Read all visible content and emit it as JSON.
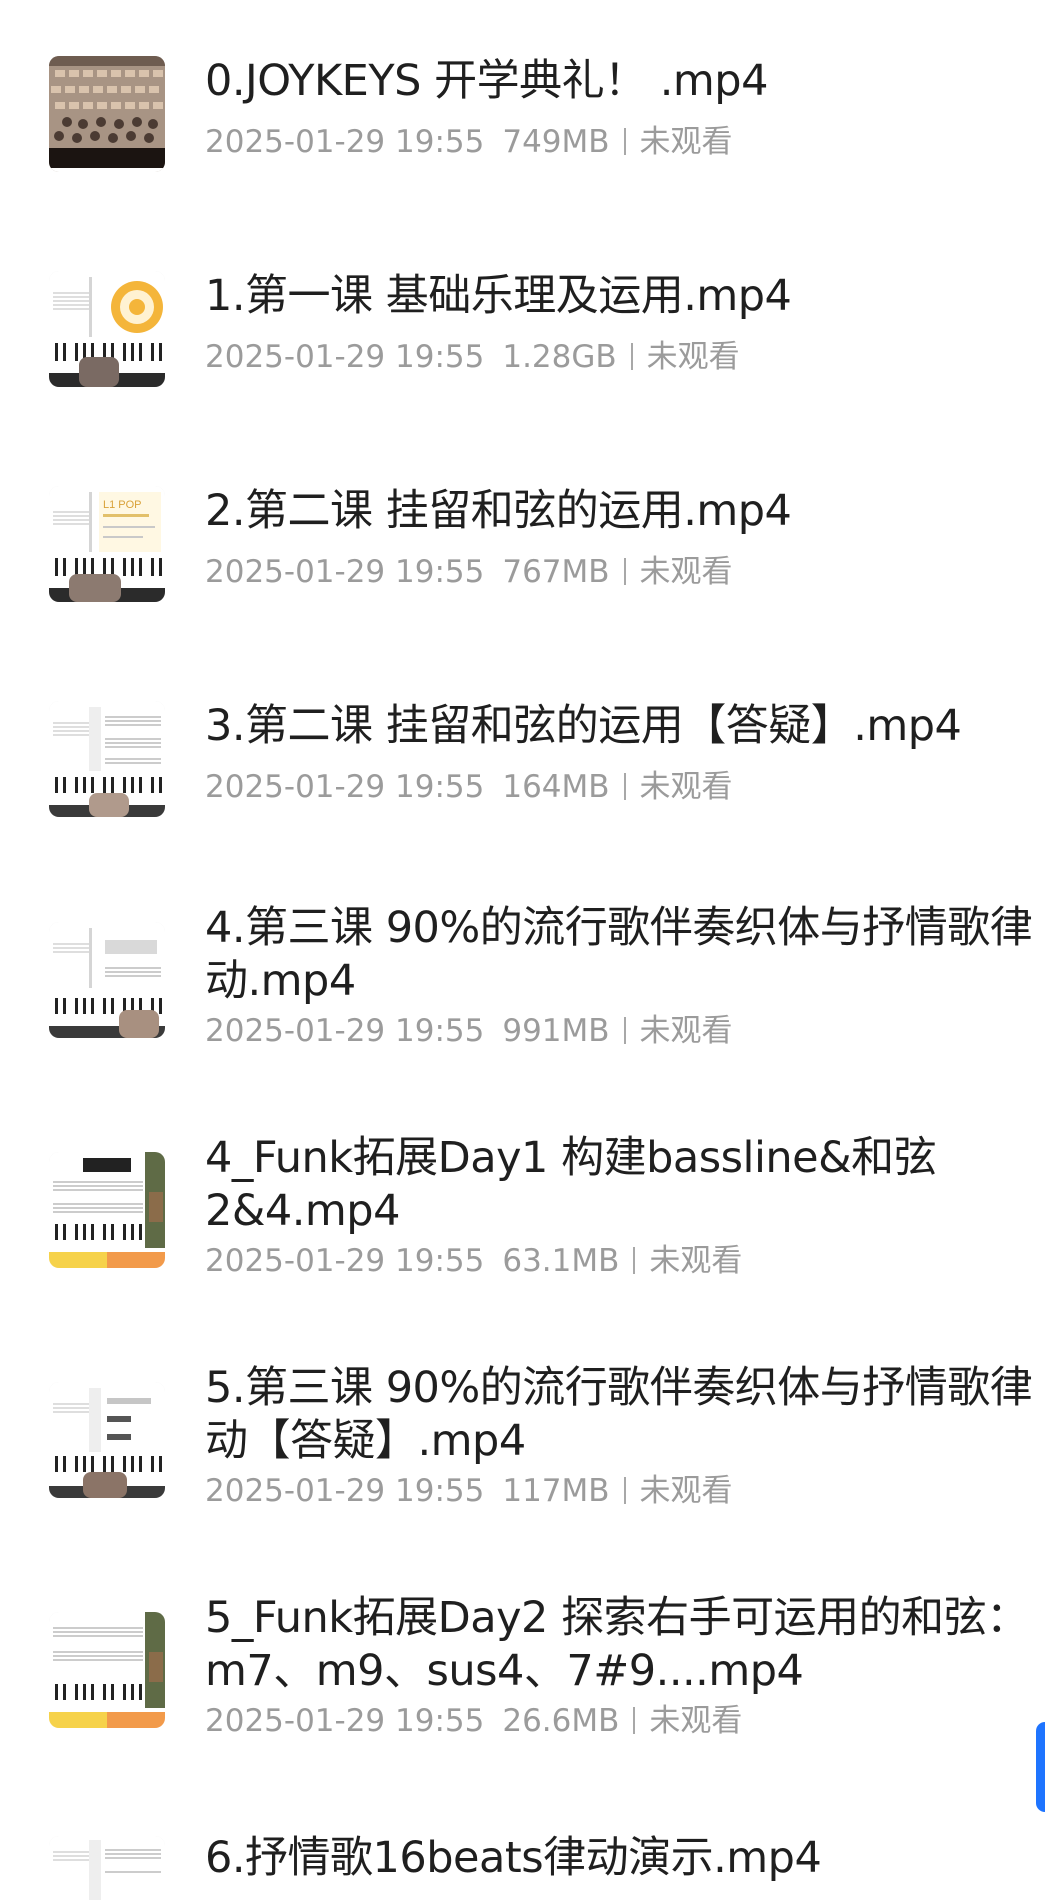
{
  "files": [
    {
      "title": "0.JOYKEYS 开学典礼！ .mp4",
      "date": "2025-01-29 19:55",
      "size": "749MB",
      "status": "未观看",
      "thumb": "ceremony"
    },
    {
      "title": "1.第一课 基础乐理及运用.mp4",
      "date": "2025-01-29 19:55",
      "size": "1.28GB",
      "status": "未观看",
      "thumb": "wheel"
    },
    {
      "title": "2.第二课 挂留和弦的运用.mp4",
      "date": "2025-01-29 19:55",
      "size": "767MB",
      "status": "未观看",
      "thumb": "slide"
    },
    {
      "title": "3.第二课 挂留和弦的运用【答疑】.mp4",
      "date": "2025-01-29 19:55",
      "size": "164MB",
      "status": "未观看",
      "thumb": "score"
    },
    {
      "title": "4.第三课 90%的流行歌伴奏织体与抒情歌律动.mp4",
      "date": "2025-01-29 19:55",
      "size": "991MB",
      "status": "未观看",
      "thumb": "score"
    },
    {
      "title": "4_Funk拓展Day1 构建bassline&和弦2&4.mp4",
      "date": "2025-01-29 19:55",
      "size": "63.1MB",
      "status": "未观看",
      "thumb": "funk"
    },
    {
      "title": "5.第三课 90%的流行歌伴奏织体与抒情歌律动【答疑】.mp4",
      "date": "2025-01-29 19:55",
      "size": "117MB",
      "status": "未观看",
      "thumb": "score"
    },
    {
      "title": "5_Funk拓展Day2 探索右手可运用的和弦：m7、m9、sus4、7#9....mp4",
      "date": "2025-01-29 19:55",
      "size": "26.6MB",
      "status": "未观看",
      "thumb": "funk"
    },
    {
      "title": "6.抒情歌16beats律动演示.mp4",
      "date": "",
      "size": "",
      "status": "",
      "thumb": "score"
    }
  ]
}
